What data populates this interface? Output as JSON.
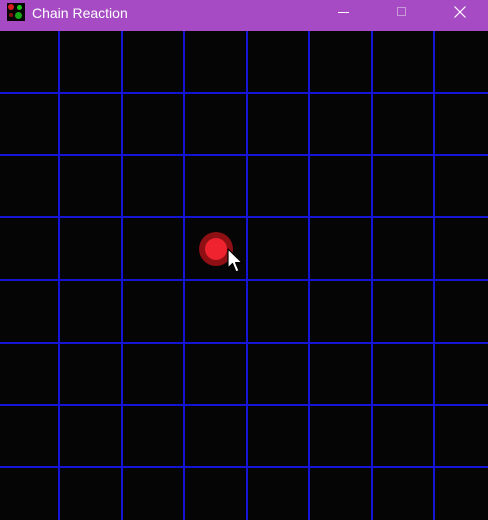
{
  "window": {
    "title": "Chain Reaction",
    "titlebar_color": "#a64bc3",
    "icon": "app-icon",
    "controls": [
      "minimize-icon",
      "maximize-icon",
      "close-icon"
    ]
  },
  "board": {
    "rows": 8,
    "cols": 8,
    "background_color": "#050505",
    "grid_color": "#1515d6",
    "cells_with_orbs": [
      {
        "row": 3,
        "col": 3,
        "player": "red",
        "orb_count": 1,
        "color": "#ef2330"
      }
    ]
  },
  "cursor": "pointer-icon"
}
